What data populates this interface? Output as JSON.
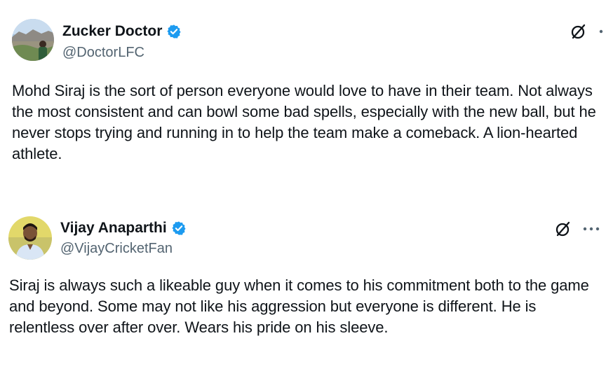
{
  "tweets": [
    {
      "display_name": "Zucker Doctor",
      "handle": "@DoctorLFC",
      "avatar_icon": "landscape-avatar-icon",
      "verified_icon": "verified-badge-icon",
      "grok_icon": "grok-icon",
      "more_icon": "more-options-icon",
      "text": "Mohd Siraj is the sort of person everyone would love to have in their team. Not always the most consistent and can bowl some bad spells, especially with the new ball, but he never stops trying and running in to help the team make a comeback. A lion-hearted athlete."
    },
    {
      "display_name": "Vijay Anaparthi",
      "handle": "@VijayCricketFan",
      "avatar_icon": "person-avatar-icon",
      "verified_icon": "verified-badge-icon",
      "grok_icon": "grok-icon",
      "more_icon": "more-options-icon",
      "text": "Siraj is always such a likeable guy when it comes to his commitment both to the game and beyond. Some may not like his aggression but everyone is different. He is relentless over after over. Wears his pride on his sleeve."
    }
  ],
  "colors": {
    "verified_blue": "#1d9bf0",
    "handle_gray": "#536471",
    "text": "#0f1419"
  }
}
